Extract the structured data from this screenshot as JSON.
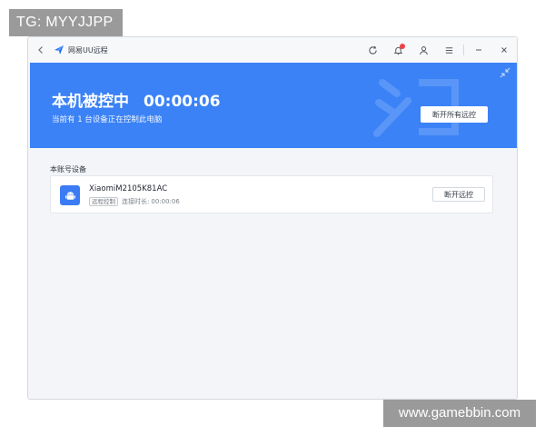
{
  "watermarks": {
    "top_left": "TG: MYYJJPP",
    "bottom_right": "www.gamebbin.com"
  },
  "titlebar": {
    "title": "网易UU远程",
    "back_icon": "back-arrow-icon",
    "icons": [
      "refresh-icon",
      "bell-icon",
      "user-icon",
      "menu-icon",
      "minimize-icon",
      "close-icon"
    ]
  },
  "banner": {
    "status": "本机被控中",
    "timer": "00:00:06",
    "subtitle": "当前有 1 台设备正在控制此电脑",
    "disconnect_all_label": "断开所有远控",
    "background_color": "#3b82f6"
  },
  "devices_section": {
    "title": "本账号设备",
    "devices": [
      {
        "name": "XiaomiM2105K81AC",
        "tag": "远程控制",
        "duration_label": "连接时长:",
        "duration": "00:00:06",
        "disconnect_label": "断开远控",
        "icon": "android-icon"
      }
    ]
  }
}
